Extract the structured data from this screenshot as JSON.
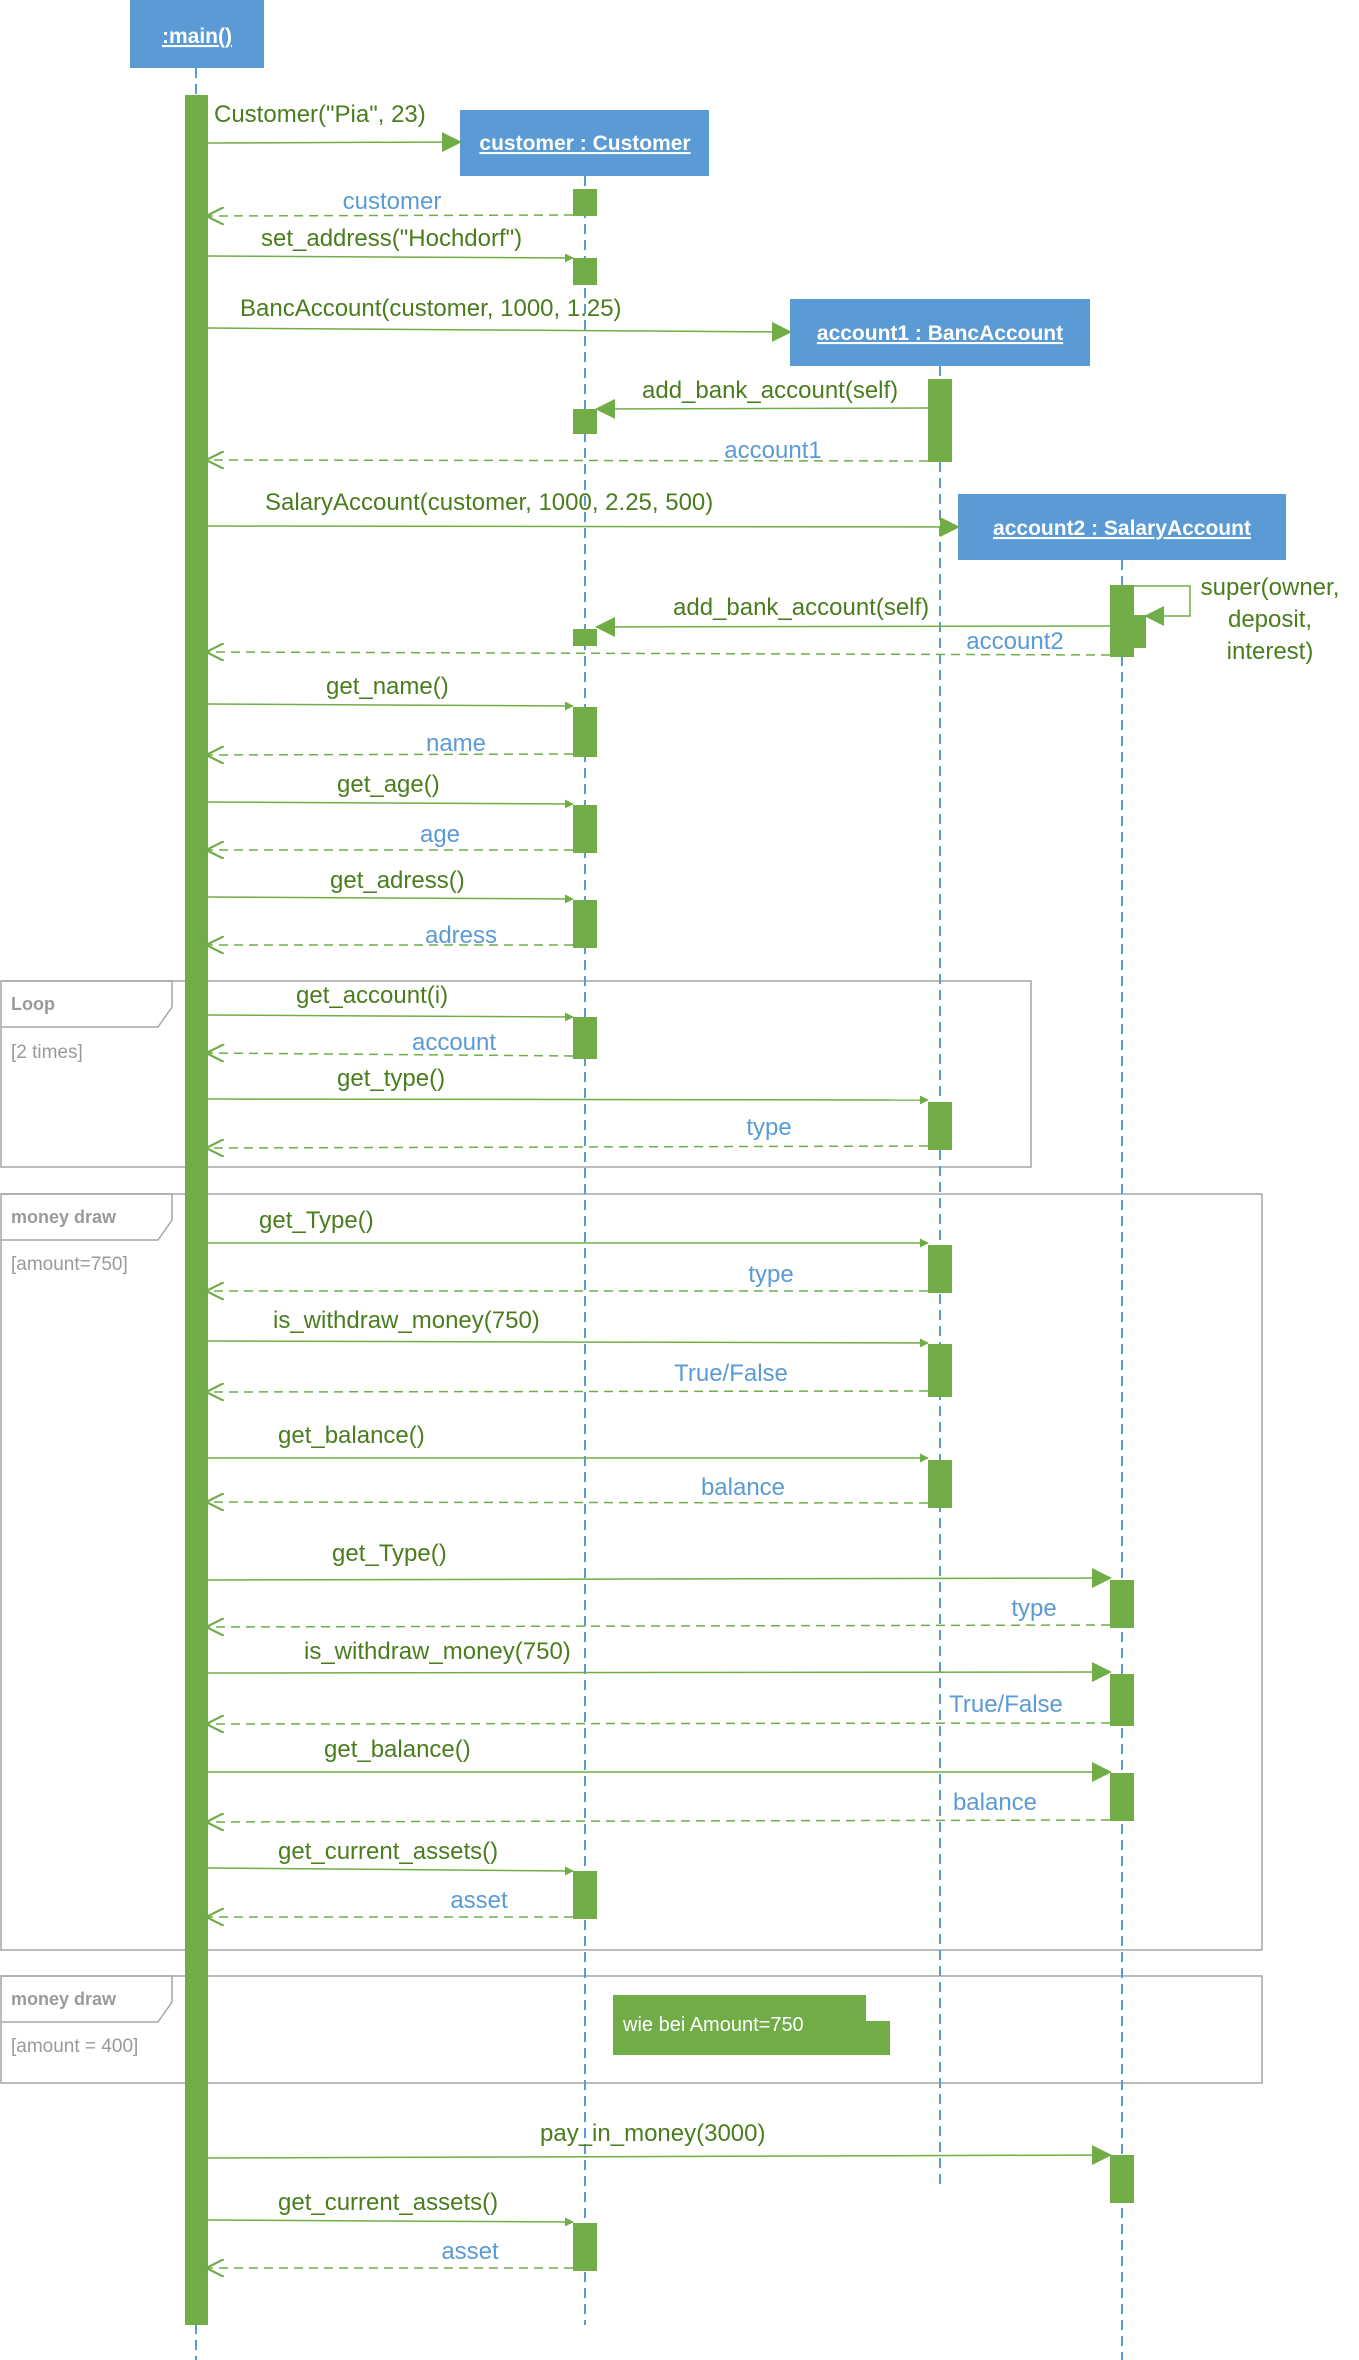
{
  "colors": {
    "participant_fill": "#5b9bd5",
    "activation_fill": "#70ad47",
    "call_text": "#4a7d1e",
    "call_line": "#70ad47",
    "return_text": "#5b9bd5",
    "lifeline": "#5b9bd5",
    "frame_border": "#a6a6a6",
    "frame_text": "#9a9a9a",
    "note_fill": "#70ad47"
  },
  "participants": [
    {
      "id": "main",
      "label": ":main()"
    },
    {
      "id": "customer",
      "label": "customer : Customer"
    },
    {
      "id": "account1",
      "label": "account1 : BancAccount"
    },
    {
      "id": "account2",
      "label": "account2 : SalaryAccount"
    }
  ],
  "messages": [
    {
      "kind": "create",
      "label": "Customer(\"Pia\", 23)"
    },
    {
      "kind": "return",
      "label": "customer"
    },
    {
      "kind": "call",
      "label": "set_address(\"Hochdorf\")"
    },
    {
      "kind": "create",
      "label": "BancAccount(customer, 1000, 1.25)"
    },
    {
      "kind": "call",
      "label": "add_bank_account(self)"
    },
    {
      "kind": "return",
      "label": "account1"
    },
    {
      "kind": "create",
      "label": "SalaryAccount(customer, 1000, 2.25, 500)"
    },
    {
      "kind": "self",
      "label": [
        "super(owner,",
        "deposit,",
        "interest)"
      ]
    },
    {
      "kind": "call",
      "label": "add_bank_account(self)"
    },
    {
      "kind": "return",
      "label": "account2"
    },
    {
      "kind": "call",
      "label": "get_name()"
    },
    {
      "kind": "return",
      "label": "name"
    },
    {
      "kind": "call",
      "label": "get_age()"
    },
    {
      "kind": "return",
      "label": "age"
    },
    {
      "kind": "call",
      "label": "get_adress()"
    },
    {
      "kind": "return",
      "label": "adress"
    },
    {
      "kind": "call",
      "label": "get_account(i)"
    },
    {
      "kind": "return",
      "label": "account"
    },
    {
      "kind": "call",
      "label": "get_type()"
    },
    {
      "kind": "return",
      "label": "type"
    },
    {
      "kind": "call",
      "label": "get_Type()"
    },
    {
      "kind": "return",
      "label": "type"
    },
    {
      "kind": "call",
      "label": "is_withdraw_money(750)"
    },
    {
      "kind": "return",
      "label": "True/False"
    },
    {
      "kind": "call",
      "label": "get_balance()"
    },
    {
      "kind": "return",
      "label": "balance"
    },
    {
      "kind": "call",
      "label": "get_Type()"
    },
    {
      "kind": "return",
      "label": "type"
    },
    {
      "kind": "call",
      "label": "is_withdraw_money(750)"
    },
    {
      "kind": "return",
      "label": "True/False"
    },
    {
      "kind": "call",
      "label": "get_balance()"
    },
    {
      "kind": "return",
      "label": "balance"
    },
    {
      "kind": "call",
      "label": "get_current_assets()"
    },
    {
      "kind": "return",
      "label": "asset"
    },
    {
      "kind": "call",
      "label": "pay_in_money(3000)"
    },
    {
      "kind": "call",
      "label": "get_current_assets()"
    },
    {
      "kind": "return",
      "label": "asset"
    }
  ],
  "fragments": [
    {
      "tag": "Loop",
      "guard": "[2 times]"
    },
    {
      "tag": "money draw",
      "guard": "[amount=750]"
    },
    {
      "tag": "money draw",
      "guard": "[amount = 400]"
    }
  ],
  "note": {
    "text": "wie bei Amount=750"
  }
}
